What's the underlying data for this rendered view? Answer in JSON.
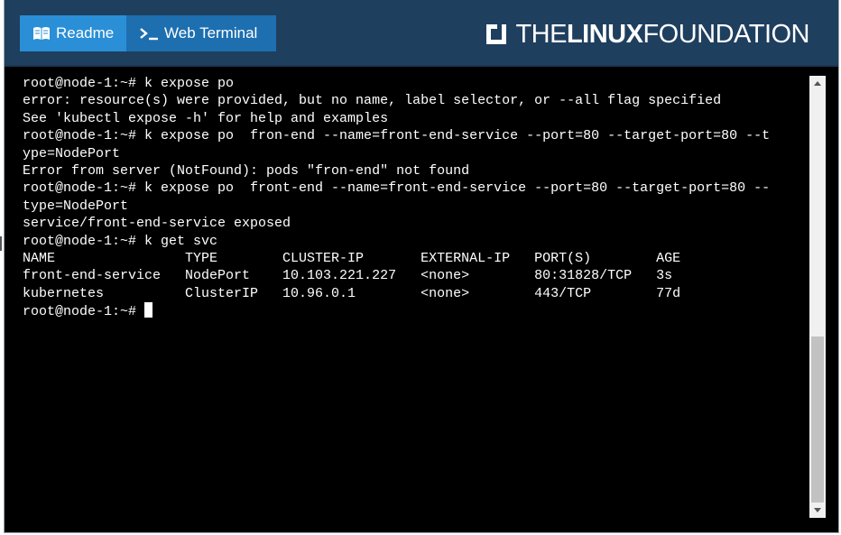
{
  "tabs": {
    "readme_label": "Readme",
    "terminal_label": "Web Terminal"
  },
  "brand": {
    "the": "THE",
    "linux": "LINUX",
    "foundation": "FOUNDATION"
  },
  "terminal": {
    "lines": [
      "root@node-1:~# k expose po",
      "error: resource(s) were provided, but no name, label selector, or --all flag specified",
      "See 'kubectl expose -h' for help and examples",
      "root@node-1:~# k expose po  fron-end --name=front-end-service --port=80 --target-port=80 --t",
      "ype=NodePort",
      "Error from server (NotFound): pods \"fron-end\" not found",
      "root@node-1:~# k expose po  front-end --name=front-end-service --port=80 --target-port=80 --",
      "type=NodePort",
      "service/front-end-service exposed",
      "root@node-1:~# k get svc",
      "NAME                TYPE        CLUSTER-IP       EXTERNAL-IP   PORT(S)        AGE",
      "front-end-service   NodePort    10.103.221.227   <none>        80:31828/TCP   3s",
      "kubernetes          ClusterIP   10.96.0.1        <none>        443/TCP        77d"
    ],
    "prompt": "root@node-1:~# "
  },
  "colors": {
    "header_bg": "#1f3f5f",
    "readme_tab": "#2a8fd6",
    "terminal_tab": "#1d6fb0",
    "terminal_bg": "#000000",
    "terminal_fg": "#ffffff"
  },
  "icons": {
    "readme": "book-icon",
    "terminal": "terminal-prompt-icon",
    "brand": "linux-foundation-logo-icon"
  }
}
